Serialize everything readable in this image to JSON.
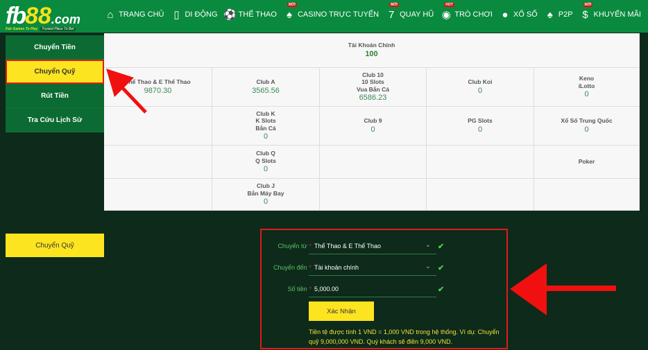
{
  "header": {
    "logo": {
      "brand": "fb",
      "digits": "88",
      "suffix": ".com",
      "tagline_left": "Fair Games To Play",
      "tagline_right": "Trusted Place To Bet"
    },
    "nav": [
      {
        "label": "TRANG CHỦ",
        "icon": "home-icon"
      },
      {
        "label": "DI ĐỘNG",
        "icon": "mobile-icon"
      },
      {
        "label": "THỂ THAO",
        "icon": "soccer-ball-icon"
      },
      {
        "label": "CASINO TRỰC TUYẾN",
        "icon": "cards-icon",
        "badge": "MỚI"
      },
      {
        "label": "QUAY HŨ",
        "icon": "slots-777-icon",
        "badge": "MỚI"
      },
      {
        "label": "TRÒ CHƠI",
        "icon": "gamepad-icon",
        "badge": "HOT"
      },
      {
        "label": "XỔ SỐ",
        "icon": "lottery-balls-icon"
      },
      {
        "label": "P2P",
        "icon": "p2p-users-icon"
      },
      {
        "label": "KHUYẾN MÃI",
        "icon": "dollar-coin-icon",
        "badge": "MỚI"
      }
    ]
  },
  "sidebar": {
    "items": [
      {
        "label": "Chuyển Tiền",
        "active": false
      },
      {
        "label": "Chuyển Quỹ",
        "active": true
      },
      {
        "label": "Rút Tiền",
        "active": false
      },
      {
        "label": "Tra Cứu Lịch Sử",
        "active": false
      }
    ]
  },
  "wallets": {
    "main": {
      "name": "Tài Khoản Chính",
      "value": "100"
    },
    "cells": [
      {
        "name": "Thể Thao & E Thể Thao",
        "value": "9870.30"
      },
      {
        "name": "Club A",
        "value": "3565.56"
      },
      {
        "name": "Club 10\n10 Slots\nVua Bắn Cá",
        "value": "6586.23"
      },
      {
        "name": "Club Koi",
        "value": "0"
      },
      {
        "name": "Keno\niLotto",
        "value": "0"
      },
      {
        "name": "",
        "value": ""
      },
      {
        "name": "Club K\nK Slots\nBắn Cá",
        "value": "0"
      },
      {
        "name": "Club 9",
        "value": "0"
      },
      {
        "name": "PG Slots",
        "value": "0"
      },
      {
        "name": "Xổ Số Trung Quốc",
        "value": "0"
      },
      {
        "name": "",
        "value": ""
      },
      {
        "name": "Club Q\nQ Slots",
        "value": "0"
      },
      {
        "name": "",
        "value": ""
      },
      {
        "name": "",
        "value": ""
      },
      {
        "name": "Poker",
        "value": ""
      },
      {
        "name": "",
        "value": ""
      },
      {
        "name": "Club J\nBắn Máy Bay",
        "value": "0"
      },
      {
        "name": "",
        "value": ""
      },
      {
        "name": "",
        "value": ""
      },
      {
        "name": "",
        "value": ""
      }
    ]
  },
  "section_button": "Chuyển Quỹ",
  "form": {
    "from_label": "Chuyển từ",
    "from_value": "Thể Thao & E Thể Thao",
    "to_label": "Chuyển đến",
    "to_value": "Tài khoản chính",
    "amount_label": "Số tiền",
    "amount_value": "5,000.00",
    "required_mark": "*",
    "submit": "Xác Nhận",
    "note": "Tiền tệ được tính 1 VND = 1,000 VND trong hệ thống. Ví dụ: Chuyển quỹ 9,000,000 VND. Quý khách sẽ điền 9,000 VND."
  },
  "colors": {
    "header": "#0a8a3e",
    "background": "#0d2a1a",
    "accent_yellow": "#fde420",
    "highlight_red": "#e01b1b",
    "value_green": "#3a8a54"
  }
}
